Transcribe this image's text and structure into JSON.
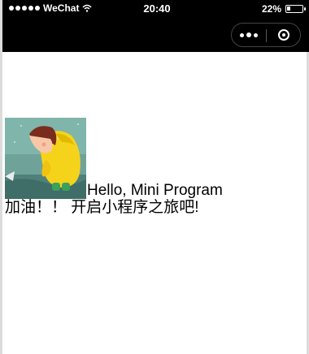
{
  "status_bar": {
    "carrier": "WeChat",
    "time": "20:40",
    "battery_percent": "22%",
    "battery_level": 0.22
  },
  "capsule": {
    "more_icon": "more-dots-icon",
    "close_icon": "close-target-icon"
  },
  "main": {
    "image_icon": "girl-in-yellow-raincoat-image",
    "greeting": "Hello, Mini Program",
    "slogan": "加油！！ 开启小程序之旅吧!"
  },
  "colors": {
    "nav_background": "#000000",
    "page_background": "#ffffff",
    "text": "#000000"
  }
}
